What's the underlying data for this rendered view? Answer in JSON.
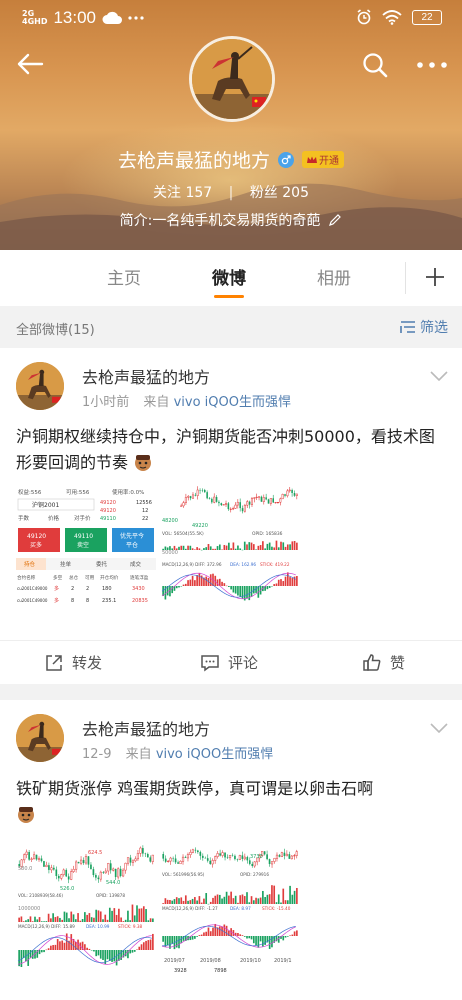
{
  "status_bar": {
    "network_1": "2G",
    "network_2": "4GHD",
    "time": "13:00",
    "battery": "22"
  },
  "profile": {
    "name": "去枪声最猛的地方",
    "vip_label": "开通",
    "following_label": "关注",
    "following_count": "157",
    "followers_label": "粉丝",
    "followers_count": "205",
    "bio": "简介:一名纯手机交易期货的奇葩"
  },
  "tabs": [
    {
      "label": "主页",
      "active": false
    },
    {
      "label": "微博",
      "active": true
    },
    {
      "label": "相册",
      "active": false
    }
  ],
  "filter": {
    "label": "全部微博(15)",
    "button": "筛选"
  },
  "posts": [
    {
      "author": "去枪声最猛的地方",
      "time": "1小时前",
      "from_label": "来自",
      "source": "vivo iQOO生而强悍",
      "text": "沪铜期权继续持仓中，沪铜期货能否冲刺50000，看技术图形要回调的节奏",
      "images": [
        {
          "kind": "trading-panel",
          "texts": {
            "rights": "权益:556",
            "available": "可用:556",
            "usage": "使用率:0.0%",
            "contract": "沪铜2001",
            "b1": "49120",
            "b2": "12556",
            "s1": "49120",
            "s2": "12",
            "s3": "49110",
            "s4": "22",
            "lots": "手数",
            "price": "价格",
            "counter": "对手价",
            "buy_price": "49120",
            "buy": "买多",
            "sell_price": "49110",
            "sell": "卖空",
            "close_first": "优先平今",
            "close": "平仓",
            "tab_positions": "持仓",
            "tab_orders": "挂单",
            "tab_cancel": "委托",
            "tab_filled": "成交",
            "col_name": "合约名称",
            "col_dir": "多空",
            "col_total": "总仓",
            "col_avail": "可用",
            "col_avg": "开仓均价",
            "col_pnl": "逐笔浮盈",
            "row1": [
              "cu2001C49000",
              "多",
              "2",
              "2",
              "180",
              "3430"
            ],
            "row2": [
              "cu2001C49000",
              "多",
              "8",
              "8",
              "235.1",
              "20835"
            ]
          }
        },
        {
          "kind": "candlestick",
          "texts": {
            "price_low": "48200",
            "price_mid": "49220",
            "vol_label": "VOL: 56504(55.5K)",
            "oi_label": "OPID: 165836",
            "macd": "MACD(12,26,9) DIFF: 372.96",
            "dea": "DEA: 162.96",
            "stick": "STICK: 419.22",
            "axis_low": "50000"
          }
        }
      ],
      "actions": {
        "repost": "转发",
        "comment": "评论",
        "like": "赞"
      }
    },
    {
      "author": "去枪声最猛的地方",
      "time": "12-9",
      "from_label": "来自",
      "source": "vivo iQOO生而强悍",
      "text": "铁矿期货涨停 鸡蛋期货跌停，真可谓是以卵击石啊",
      "images": [
        {
          "kind": "candlestick",
          "texts": {
            "price_high": "624.5",
            "price_low": "544.0",
            "price_left": "580.0",
            "price_min": "526.0",
            "vol_label": "VOL: 2108939(58.46)",
            "oi_label": "OPID: 139878",
            "axis": "1000000",
            "macd": "MACD(12,26,9) DIFF: 15.89",
            "dea": "DEA: 10.99",
            "stick": "STICK: 9.38"
          }
        },
        {
          "kind": "candlestick",
          "texts": {
            "price_low": "3730",
            "vol_label": "VOL: 561996(56.95)",
            "oi_label": "OPID: 279916",
            "macd": "MACD(12,26,9) DIFF: -1.27",
            "dea": "DEA: 8.97",
            "stick": "STICK: -15.40",
            "d1": "2019/07",
            "d2": "2019/08",
            "d3": "2019/10",
            "d4": "2019/1"
          }
        }
      ],
      "bottom_texts": {
        "a": "3928",
        "b": "7898"
      }
    }
  ],
  "colors": {
    "accent": "#ff8200",
    "link": "#507daf",
    "up": "#e03c3c",
    "down": "#1aa260",
    "macd_line": "#d040d0",
    "dea_line": "#3c6fd0"
  }
}
